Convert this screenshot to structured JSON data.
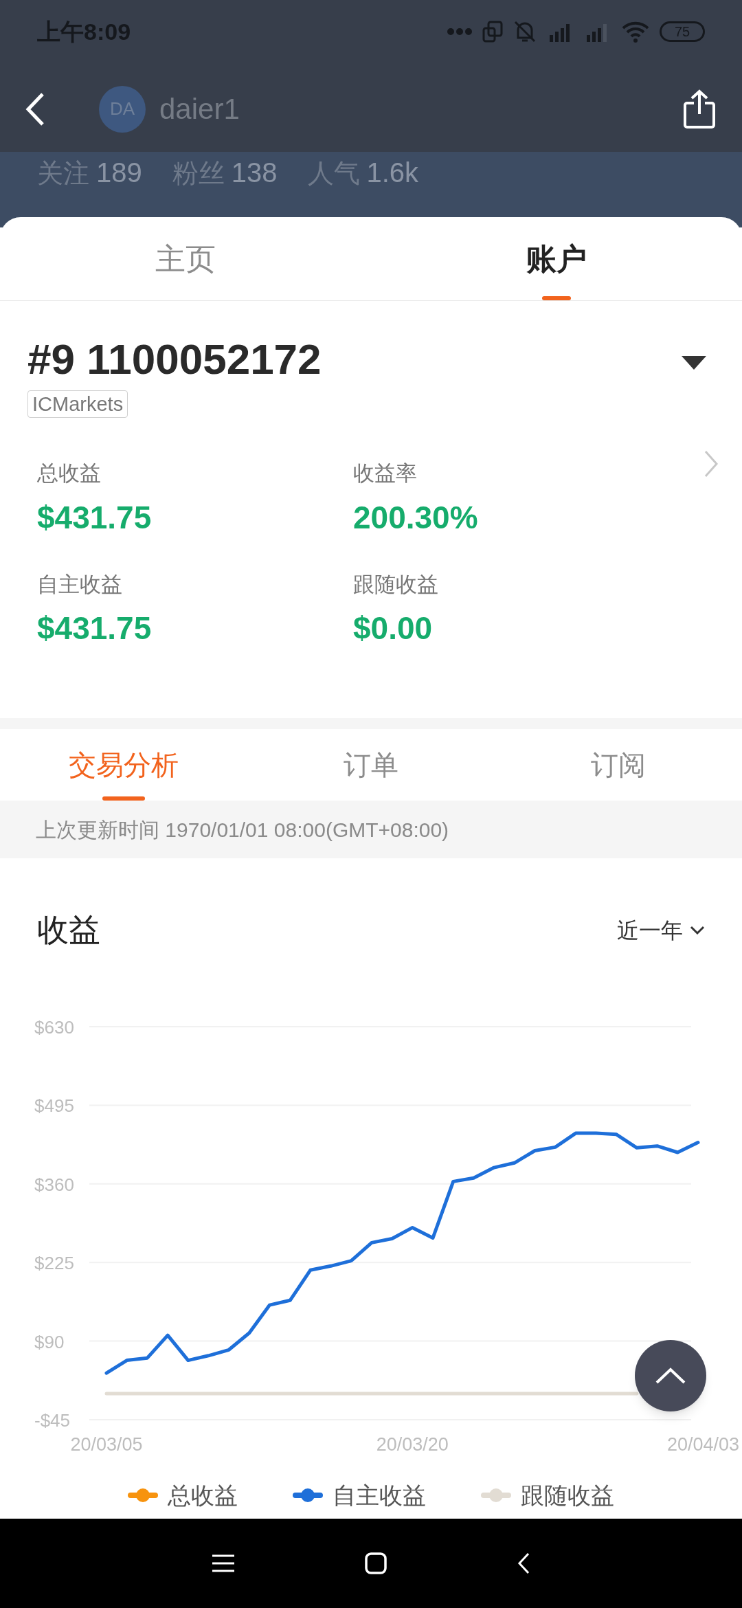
{
  "status_bar": {
    "time": "上午8:09",
    "battery": "75"
  },
  "header": {
    "avatar": "DA",
    "username": "daier1",
    "stats": [
      {
        "label": "关注",
        "value": "189"
      },
      {
        "label": "粉丝",
        "value": "138"
      },
      {
        "label": "人气",
        "value": "1.6k"
      }
    ]
  },
  "tabs": [
    {
      "label": "主页",
      "selected": false
    },
    {
      "label": "账户",
      "selected": true
    }
  ],
  "account": {
    "title": "#9 1100052172",
    "broker": "ICMarkets",
    "metrics": [
      {
        "label": "总收益",
        "value": "$431.75"
      },
      {
        "label": "收益率",
        "value": "200.30%"
      },
      {
        "label": "自主收益",
        "value": "$431.75"
      },
      {
        "label": "跟随收益",
        "value": "$0.00"
      }
    ]
  },
  "sub_tabs": [
    {
      "label": "交易分析",
      "selected": true
    },
    {
      "label": "订单",
      "selected": false
    },
    {
      "label": "订阅",
      "selected": false
    }
  ],
  "update_note": "上次更新时间 1970/01/01 08:00(GMT+08:00)",
  "chart": {
    "title": "收益",
    "period": "近一年",
    "chart_data": {
      "type": "line",
      "categories": [
        "20/03/05",
        null,
        null,
        null,
        null,
        null,
        null,
        null,
        null,
        null,
        null,
        null,
        null,
        null,
        null,
        "20/03/20",
        null,
        null,
        null,
        null,
        null,
        null,
        null,
        null,
        null,
        null,
        null,
        null,
        null,
        "20/04/03"
      ],
      "series": [
        {
          "name": "总收益",
          "color": "#f7930e",
          "values": [
            null,
            null,
            null,
            null,
            null,
            null,
            null,
            null,
            null,
            null,
            null,
            null,
            null,
            null,
            null,
            null,
            null,
            null,
            null,
            null,
            null,
            null,
            null,
            null,
            null,
            null,
            null,
            null,
            null,
            null
          ]
        },
        {
          "name": "自主收益",
          "color": "#1e6fd9",
          "values": [
            35,
            57,
            61,
            100,
            57,
            65,
            75,
            104,
            152,
            160,
            212,
            219,
            228,
            259,
            266,
            285,
            267,
            364,
            370,
            388,
            396,
            417,
            423,
            447,
            447,
            445,
            422,
            425,
            414,
            431
          ]
        },
        {
          "name": "跟随收益",
          "color": "#e2dcd3",
          "values": [
            0,
            0,
            0,
            0,
            0,
            0,
            0,
            0,
            0,
            0,
            0,
            0,
            0,
            0,
            0,
            0,
            0,
            0,
            0,
            0,
            0,
            0,
            0,
            0,
            0,
            0,
            0,
            null,
            null,
            null
          ]
        }
      ],
      "grid": true,
      "ylim": [
        -45,
        630
      ],
      "yticks": [
        {
          "value": 630,
          "label": "$630"
        },
        {
          "value": 495,
          "label": "$495"
        },
        {
          "value": 360,
          "label": "$360"
        },
        {
          "value": 225,
          "label": "$225"
        },
        {
          "value": 90,
          "label": "$90"
        },
        {
          "value": -45,
          "label": "-$45"
        }
      ]
    }
  }
}
